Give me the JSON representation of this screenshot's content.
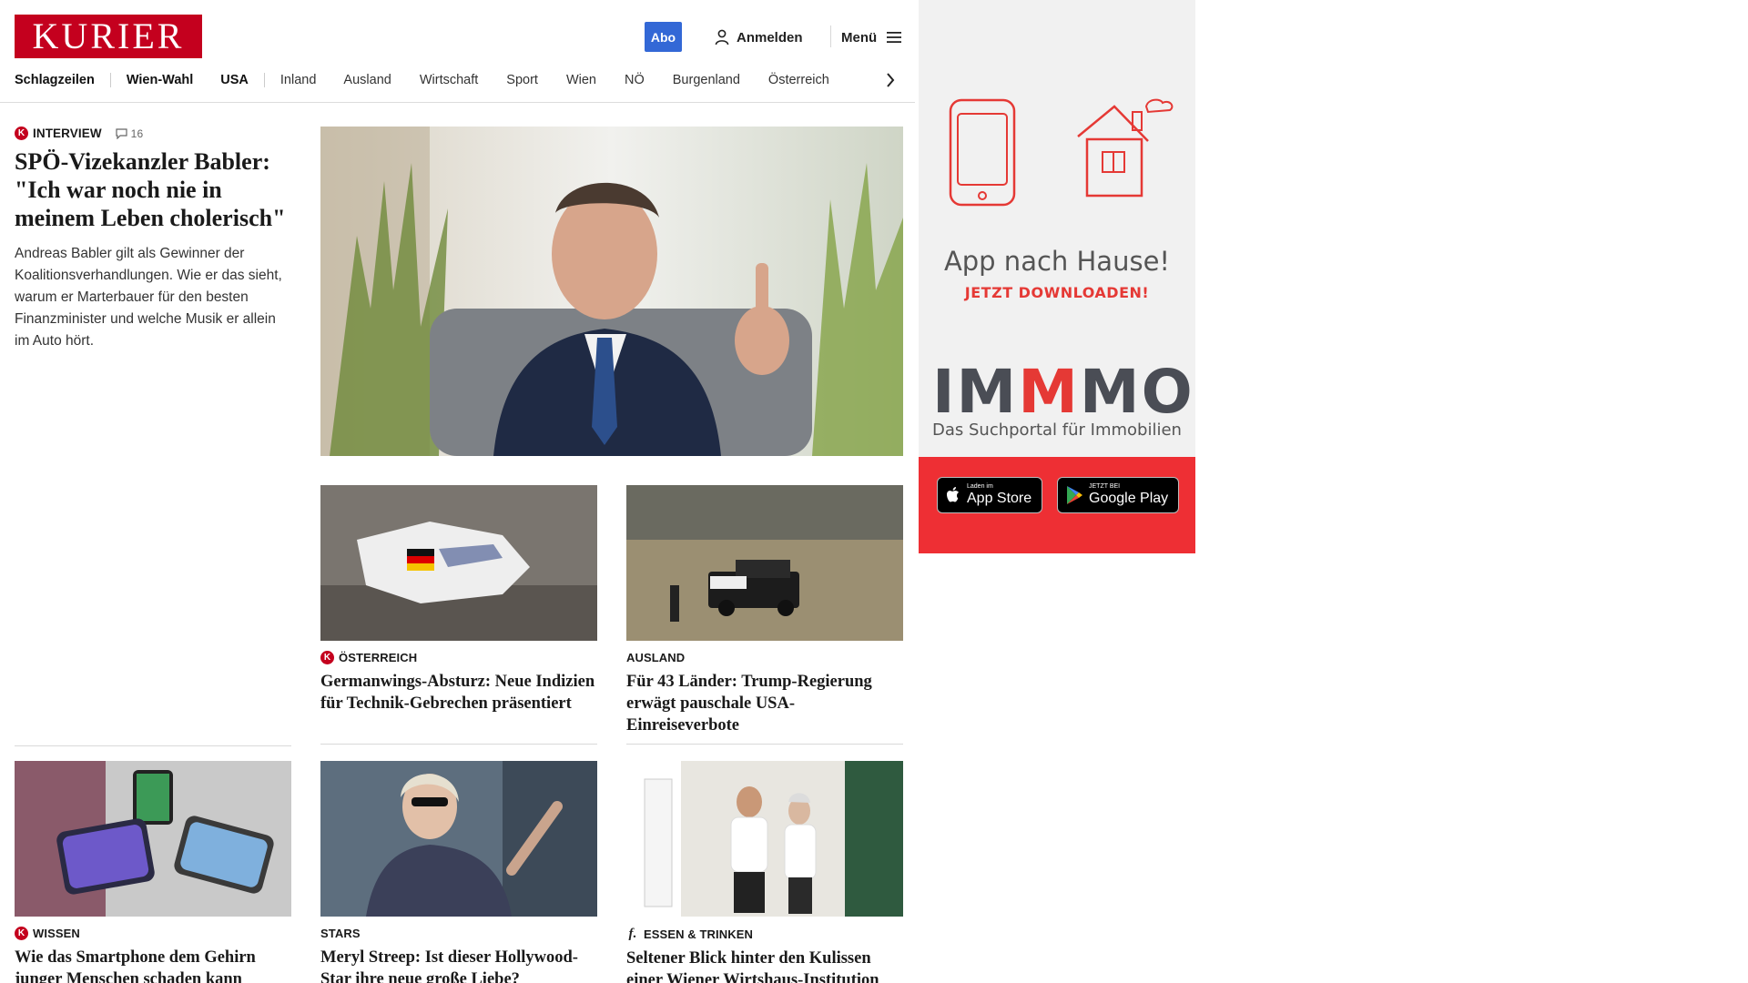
{
  "header": {
    "logo_text": "KURIER",
    "abo_label": "Abo",
    "login_label": "Anmelden",
    "menu_label": "Menü"
  },
  "nav": {
    "items": [
      "Schlagzeilen",
      "Wien-Wahl",
      "USA",
      "Inland",
      "Ausland",
      "Wirtschaft",
      "Sport",
      "Wien",
      "NÖ",
      "Burgenland",
      "Österreich"
    ],
    "bold_items": [
      "Schlagzeilen",
      "Wien-Wahl",
      "USA"
    ]
  },
  "lead": {
    "kicker": "INTERVIEW",
    "comment_count": "16",
    "headline": "SPÖ-Vizekanzler Babler: \"Ich war noch nie in meinem Leben cholerisch\"",
    "teaser": "Andreas Babler gilt als Gewinner der Koalitionsverhandlungen. Wie er das sieht, warum er Marterbauer für den besten Finanzminister und welche Musik er allein im Auto hört."
  },
  "cards": [
    {
      "kicker": "ÖSTERREICH",
      "badge": "k",
      "headline": "Germanwings-Absturz: Neue Indizien für Technik-Gebrechen präsentiert"
    },
    {
      "kicker": "AUSLAND",
      "badge": "",
      "headline": "Für 43 Länder: Trump-Regierung erwägt pauschale USA-Einreiseverbote"
    },
    {
      "kicker": "WISSEN",
      "badge": "k",
      "headline": "Wie das Smartphone dem Gehirn junger Menschen schaden kann"
    },
    {
      "kicker": "STARS",
      "badge": "",
      "headline": "Meryl Streep: Ist dieser Hollywood-Star ihre neue große Liebe?"
    },
    {
      "kicker": "ESSEN & TRINKEN",
      "badge": "f",
      "headline": "Seltener Blick hinter den Kulissen einer Wiener Wirtshaus-Institution"
    }
  ],
  "ad": {
    "title": "App nach Hause!",
    "subtitle": "JETZT DOWNLOADEN!",
    "brand_parts": [
      "IM",
      "M",
      "MO"
    ],
    "tagline": "Das Suchportal für Immobilien",
    "appstore_small": "Laden im",
    "appstore_big": "App Store",
    "googleplay_small": "JETZT BEI",
    "googleplay_big": "Google Play"
  },
  "colors": {
    "brand_red": "#c4001e",
    "abo_blue": "#3368d6",
    "ad_red": "#ee2f34",
    "ad_bg": "#f1f1f1"
  },
  "icons": {
    "login": "user-icon",
    "menu": "hamburger-icon",
    "comments": "speech-bubble-icon",
    "nav_more": "chevron-right-icon"
  }
}
